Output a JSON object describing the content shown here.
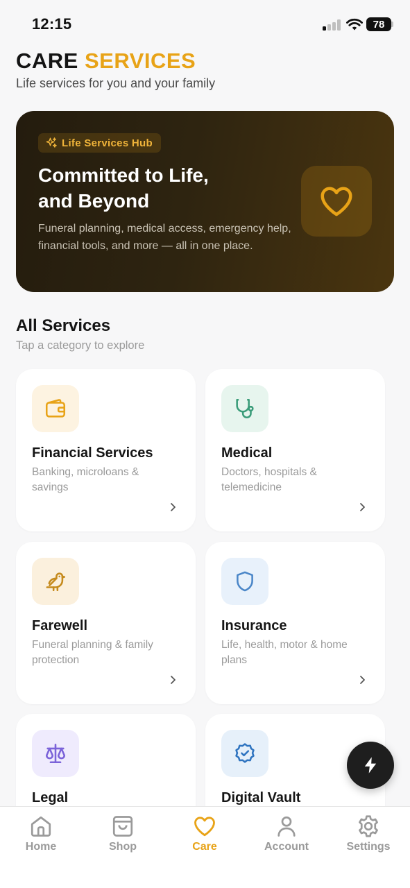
{
  "status_bar": {
    "time": "12:15",
    "battery": "78"
  },
  "header": {
    "title_main": "CARE",
    "title_accent": "SERVICES",
    "subtitle": "Life services for you and your family"
  },
  "hero": {
    "badge": "Life Services Hub",
    "title_line1": "Committed to Life,",
    "title_line2": "and Beyond",
    "description": "Funeral planning, medical access, emergency help, financial tools, and more — all in one place.",
    "icon": "heart-icon"
  },
  "section": {
    "title": "All Services",
    "subtitle": "Tap a category to explore"
  },
  "services": [
    {
      "title": "Financial Services",
      "description": "Banking, microloans & savings",
      "icon": "wallet-icon",
      "icon_color": "#E8A317",
      "icon_bg": "#FDF3E1"
    },
    {
      "title": "Medical",
      "description": "Doctors, hospitals & telemedicine",
      "icon": "stethoscope-icon",
      "icon_color": "#3A9C79",
      "icon_bg": "#E7F5EE"
    },
    {
      "title": "Farewell",
      "description": "Funeral planning & family protection",
      "icon": "bird-icon",
      "icon_color": "#C58A1C",
      "icon_bg": "#FBF0DD"
    },
    {
      "title": "Insurance",
      "description": "Life, health, motor & home plans",
      "icon": "shield-icon",
      "icon_color": "#4A86C8",
      "icon_bg": "#E8F1FB"
    },
    {
      "title": "Legal",
      "description": "",
      "icon": "scales-icon",
      "icon_color": "#7B63D9",
      "icon_bg": "#EFEBFD"
    },
    {
      "title": "Digital Vault",
      "description": "",
      "icon": "verified-badge-icon",
      "icon_color": "#2F74C0",
      "icon_bg": "#E6F0FA"
    }
  ],
  "tabs": [
    {
      "label": "Home",
      "icon": "home-icon",
      "active": false
    },
    {
      "label": "Shop",
      "icon": "shopping-bag-icon",
      "active": false
    },
    {
      "label": "Care",
      "icon": "heart-icon",
      "active": true
    },
    {
      "label": "Account",
      "icon": "user-icon",
      "active": false
    },
    {
      "label": "Settings",
      "icon": "gear-icon",
      "active": false
    }
  ],
  "colors": {
    "accent": "#E8A317",
    "inactive": "#9A9A9A",
    "background": "#F7F7F8",
    "hero_dark": "#2A2110"
  }
}
